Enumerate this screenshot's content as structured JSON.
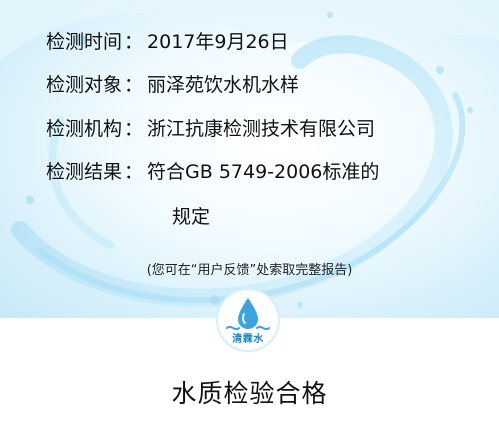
{
  "report": {
    "rows": [
      {
        "key": "检测时间",
        "sep": "：",
        "value": "2017年9月26日"
      },
      {
        "key": "检测对象",
        "sep": "：",
        "value": "丽泽苑饮水机水样"
      },
      {
        "key": "检测机构",
        "sep": "：",
        "value": "浙江抗康检测技术有限公司"
      },
      {
        "key": "检测结果",
        "sep": "：",
        "value": "符合GB 5749-2006标准的"
      }
    ],
    "result_continuation": "规定",
    "note": "(您可在“用户反馈”处索取完整报告)"
  },
  "logo": {
    "text": "清霖水",
    "icon": "water-drop-icon"
  },
  "footer": {
    "title": "水质检验合格"
  },
  "colors": {
    "accent": "#1a86c8",
    "background_top": "#d7f0fb"
  }
}
